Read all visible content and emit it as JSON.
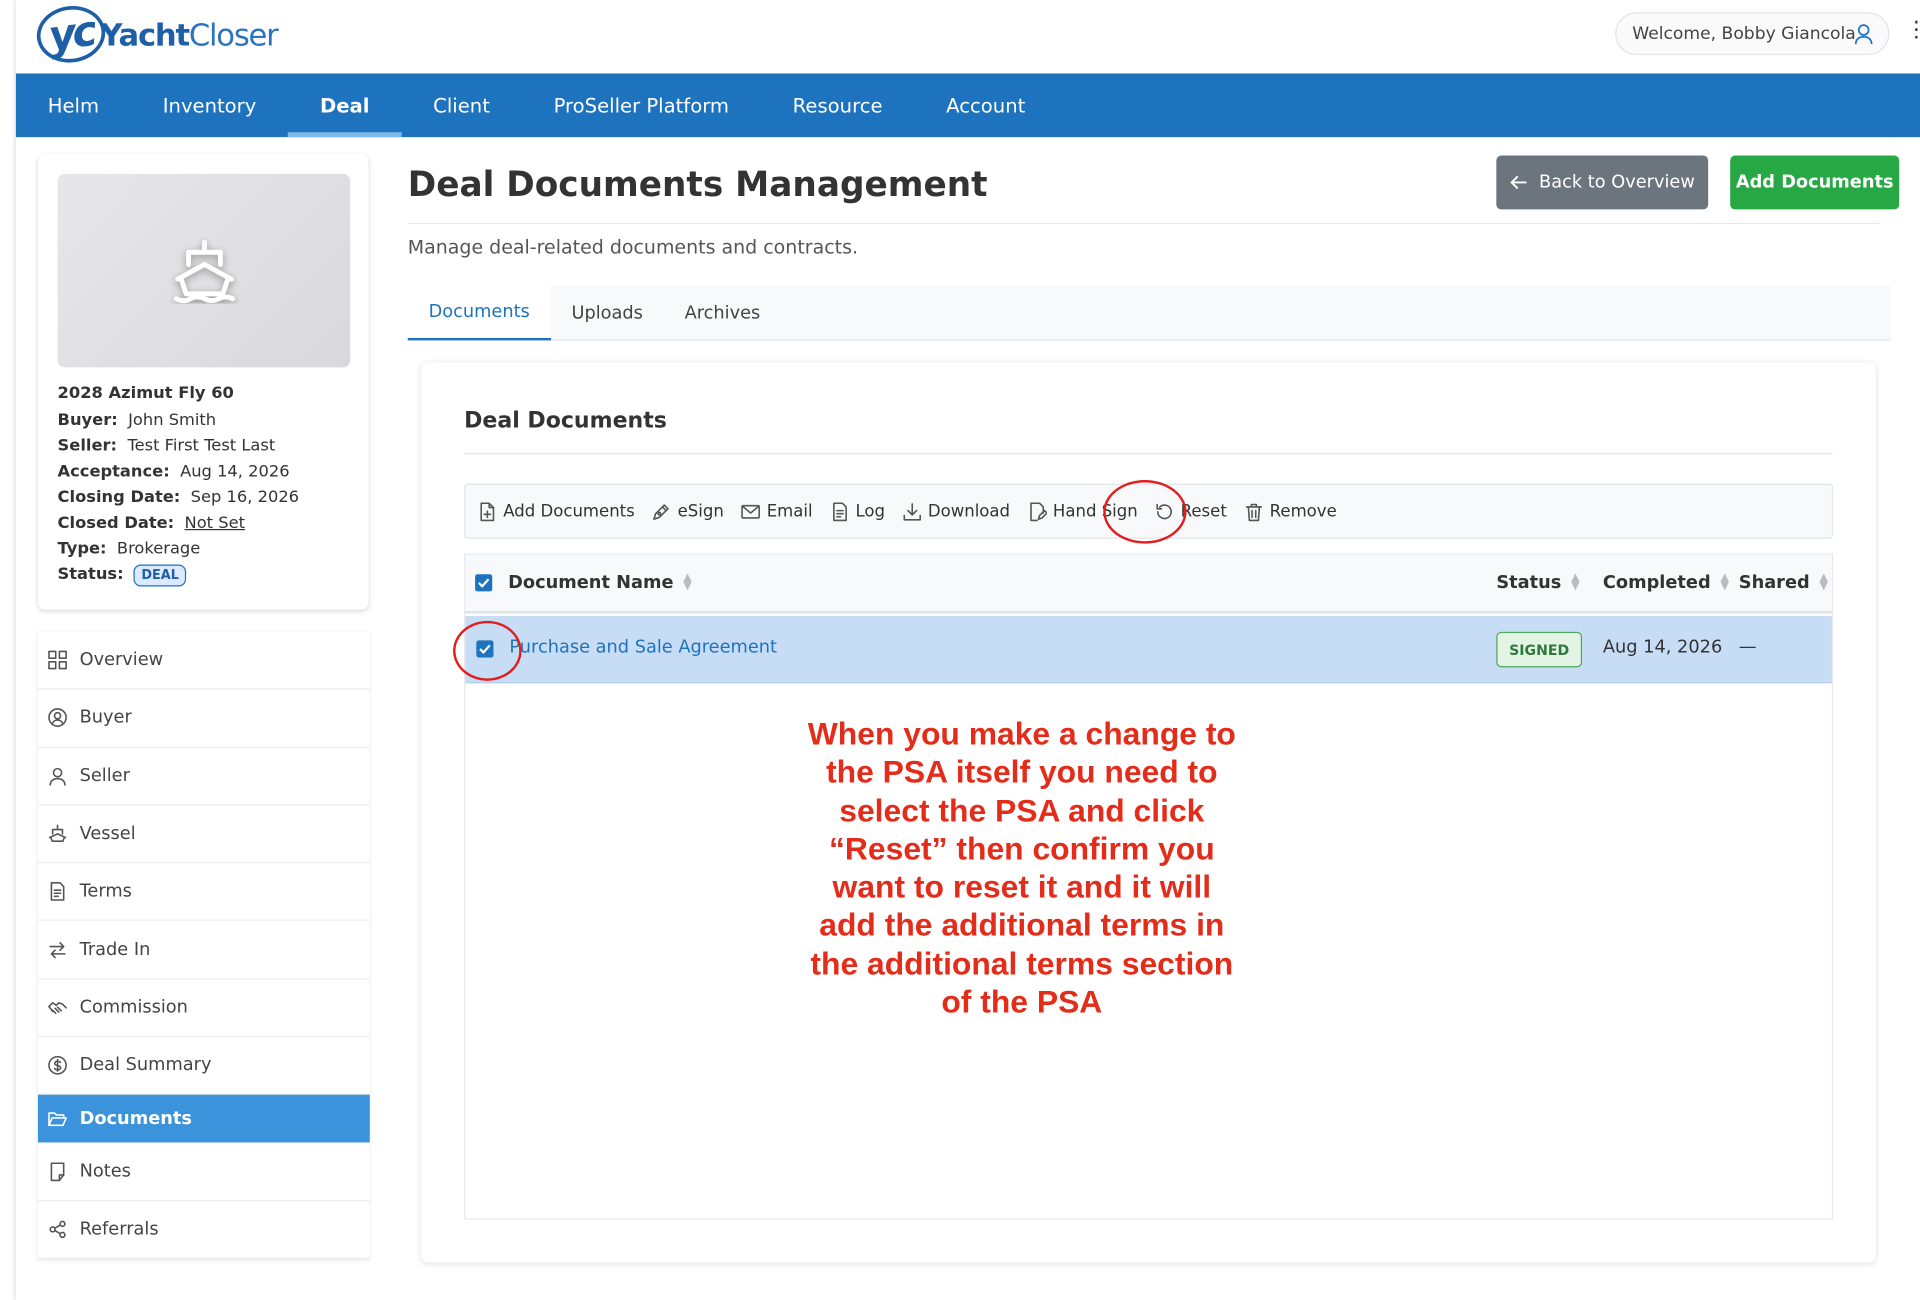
{
  "brand": {
    "logo_mark": "yc",
    "name_bold": "Yacht",
    "name_light": "Closer"
  },
  "header": {
    "welcome": "Welcome, Bobby Giancola"
  },
  "nav": {
    "items": [
      "Helm",
      "Inventory",
      "Deal",
      "Client",
      "ProSeller Platform",
      "Resource",
      "Account"
    ],
    "active": "Deal"
  },
  "vessel": {
    "title": "2028 Azimut Fly 60",
    "buyer_label": "Buyer:",
    "buyer": "John Smith",
    "seller_label": "Seller:",
    "seller": "Test First Test Last",
    "acceptance_label": "Acceptance:",
    "acceptance": "Aug 14, 2026",
    "closing_label": "Closing Date:",
    "closing": "Sep 16, 2026",
    "closed_label": "Closed Date:",
    "closed": "Not Set",
    "type_label": "Type:",
    "type": "Brokerage",
    "status_label": "Status:",
    "status": "DEAL"
  },
  "sidebar": {
    "items": [
      {
        "label": "Overview",
        "icon": "grid-icon"
      },
      {
        "label": "Buyer",
        "icon": "user-circle-icon"
      },
      {
        "label": "Seller",
        "icon": "user-icon"
      },
      {
        "label": "Vessel",
        "icon": "ship-icon"
      },
      {
        "label": "Terms",
        "icon": "document-icon"
      },
      {
        "label": "Trade In",
        "icon": "swap-icon"
      },
      {
        "label": "Commission",
        "icon": "handshake-icon"
      },
      {
        "label": "Deal Summary",
        "icon": "dollar-circle-icon"
      },
      {
        "label": "Documents",
        "icon": "folder-open-icon"
      },
      {
        "label": "Notes",
        "icon": "note-icon"
      },
      {
        "label": "Referrals",
        "icon": "share-icon"
      }
    ],
    "active": "Documents"
  },
  "page": {
    "title": "Deal Documents Management",
    "subtitle": "Manage deal-related documents and contracts.",
    "back_button": "Back to Overview",
    "add_button": "Add Documents"
  },
  "tabs": {
    "items": [
      "Documents",
      "Uploads",
      "Archives"
    ],
    "active": "Documents"
  },
  "documents": {
    "section_title": "Deal Documents",
    "toolbar": [
      "Add Documents",
      "eSign",
      "Email",
      "Log",
      "Download",
      "Hand Sign",
      "Reset",
      "Remove"
    ],
    "columns": {
      "name": "Document Name",
      "status": "Status",
      "completed": "Completed",
      "shared": "Shared"
    },
    "rows": [
      {
        "name": "Purchase and Sale Agreement",
        "status": "SIGNED",
        "completed": "Aug 14, 2026",
        "shared": "—",
        "selected": true
      }
    ]
  },
  "annotation": {
    "lines": [
      "When you make a change to",
      "the PSA itself you need to",
      "select the PSA and click",
      "“Reset” then confirm you",
      "want to reset it and it will",
      "add the additional terms in",
      "the additional terms section",
      "of the PSA"
    ],
    "color": "#e42c1a"
  },
  "colors": {
    "primary": "#1e73be",
    "success": "#28a745",
    "secondary": "#6c757d",
    "highlight_row": "#c7dcf5"
  }
}
